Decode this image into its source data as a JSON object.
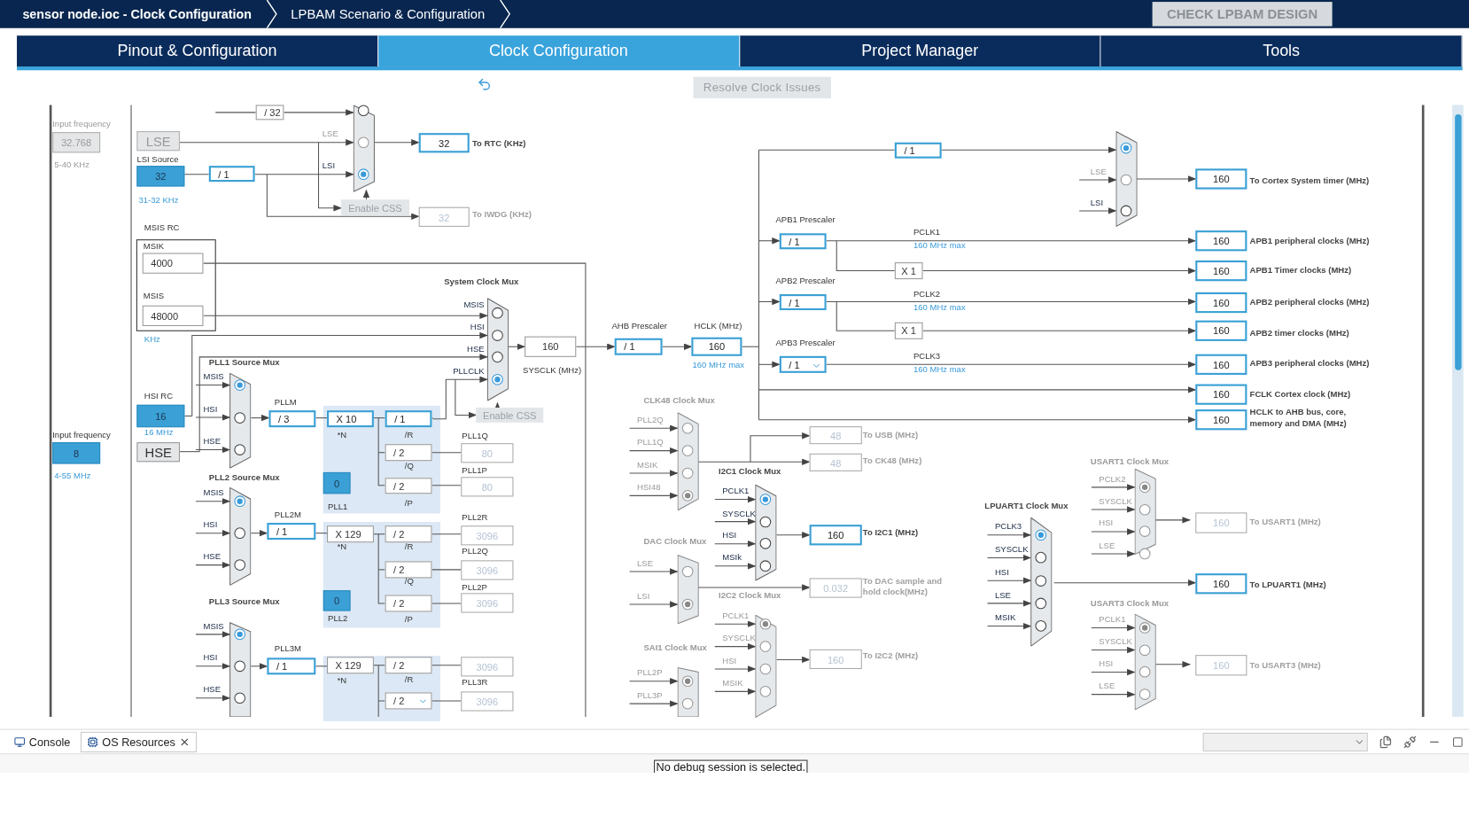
{
  "breadcrumbs": [
    {
      "label": "sensor node.ioc - Clock Configuration"
    },
    {
      "label": "LPBAM Scenario & Configuration"
    }
  ],
  "check_button": "CHECK LPBAM DESIGN",
  "tabs": [
    {
      "label": "Pinout & Configuration",
      "selected": false
    },
    {
      "label": "Clock Configuration",
      "selected": true
    },
    {
      "label": "Project Manager",
      "selected": false
    },
    {
      "label": "Tools",
      "selected": false
    }
  ],
  "toolbar": {
    "resolve_button": "Resolve Clock Issues"
  },
  "diagram": {
    "fields": [
      {
        "value": "32.768",
        "kind": "source_off"
      },
      {
        "value": "LSE",
        "kind": "source_off"
      },
      {
        "value": "32",
        "kind": "filled"
      },
      {
        "value": "/ 1",
        "kind": "active"
      },
      {
        "value": "/ 32",
        "kind": "plain"
      },
      {
        "value": "32",
        "kind": "active"
      },
      {
        "value": "32",
        "kind": "disabled"
      },
      {
        "value": "4000",
        "kind": "plain"
      },
      {
        "value": "48000",
        "kind": "plain"
      },
      {
        "value": "16",
        "kind": "filled"
      },
      {
        "value": "8",
        "kind": "filled"
      },
      {
        "value": "HSE",
        "kind": "source"
      },
      {
        "value": "160",
        "kind": "plain"
      },
      {
        "value": "/ 3",
        "kind": "active"
      },
      {
        "value": "X 10",
        "kind": "active"
      },
      {
        "value": "/ 1",
        "kind": "active"
      },
      {
        "value": "/ 2",
        "kind": "plain"
      },
      {
        "value": "0",
        "kind": "filled"
      },
      {
        "value": "/ 2",
        "kind": "plain"
      },
      {
        "value": "80",
        "kind": "disabled"
      },
      {
        "value": "80",
        "kind": "disabled"
      },
      {
        "value": "/ 1",
        "kind": "active"
      },
      {
        "value": "X 129",
        "kind": "plain"
      },
      {
        "value": "/ 2",
        "kind": "plain"
      },
      {
        "value": "/ 2",
        "kind": "plain"
      },
      {
        "value": "0",
        "kind": "filled"
      },
      {
        "value": "/ 2",
        "kind": "plain"
      },
      {
        "value": "3096",
        "kind": "disabled"
      },
      {
        "value": "3096",
        "kind": "disabled"
      },
      {
        "value": "3096",
        "kind": "disabled"
      },
      {
        "value": "/ 1",
        "kind": "active"
      },
      {
        "value": "X 129",
        "kind": "plain"
      },
      {
        "value": "/ 2",
        "kind": "plain"
      },
      {
        "value": "/ 2",
        "kind": "plain_select"
      },
      {
        "value": "3096",
        "kind": "disabled"
      },
      {
        "value": "3096",
        "kind": "disabled"
      },
      {
        "value": "/ 1",
        "kind": "active"
      },
      {
        "value": "160",
        "kind": "active"
      },
      {
        "value": "/ 1",
        "kind": "active"
      },
      {
        "value": "/ 1",
        "kind": "active"
      },
      {
        "value": "X 1",
        "kind": "plain"
      },
      {
        "value": "/ 1",
        "kind": "active"
      },
      {
        "value": "X 1",
        "kind": "plain"
      },
      {
        "value": "/ 1",
        "kind": "active_select"
      },
      {
        "value": "160",
        "kind": "active"
      },
      {
        "value": "160",
        "kind": "active"
      },
      {
        "value": "160",
        "kind": "active"
      },
      {
        "value": "160",
        "kind": "active"
      },
      {
        "value": "160",
        "kind": "active"
      },
      {
        "value": "160",
        "kind": "active"
      },
      {
        "value": "160",
        "kind": "active"
      },
      {
        "value": "160",
        "kind": "active"
      },
      {
        "value": "48",
        "kind": "disabled"
      },
      {
        "value": "48",
        "kind": "disabled"
      },
      {
        "value": "160",
        "kind": "active"
      },
      {
        "value": "0.032",
        "kind": "disabled"
      },
      {
        "value": "160",
        "kind": "disabled"
      },
      {
        "value": "160",
        "kind": "disabled"
      },
      {
        "value": "160",
        "kind": "active"
      },
      {
        "value": "160",
        "kind": "disabled"
      }
    ],
    "labels": [
      {
        "text": "Input frequency",
        "kind": "grey"
      },
      {
        "text": "5-40 KHz",
        "kind": "grey"
      },
      {
        "text": "LSI Source",
        "kind": "dark"
      },
      {
        "text": "31-32 KHz",
        "kind": "blue"
      },
      {
        "text": "To RTC (KHz)",
        "kind": "bold"
      },
      {
        "text": "To IWDG (KHz)",
        "kind": "greybold"
      },
      {
        "text": "MSIS RC",
        "kind": "dark"
      },
      {
        "text": "MSIK",
        "kind": "dark"
      },
      {
        "text": "MSIS",
        "kind": "dark"
      },
      {
        "text": "KHz",
        "kind": "blue"
      },
      {
        "text": "HSI RC",
        "kind": "dark"
      },
      {
        "text": "Input frequency",
        "kind": "dark"
      },
      {
        "text": "16 MHz",
        "kind": "blue"
      },
      {
        "text": "4-55 MHz",
        "kind": "blue"
      },
      {
        "text": "SYSCLK (MHz)",
        "kind": "dark"
      },
      {
        "text": "PLLM",
        "kind": "dark"
      },
      {
        "text": "*N",
        "kind": "dark"
      },
      {
        "text": "/R",
        "kind": "dark"
      },
      {
        "text": "/Q",
        "kind": "dark"
      },
      {
        "text": "PLL1",
        "kind": "dark"
      },
      {
        "text": "/P",
        "kind": "dark"
      },
      {
        "text": "PLL1Q",
        "kind": "dark"
      },
      {
        "text": "PLL1P",
        "kind": "dark"
      },
      {
        "text": "PLL2M",
        "kind": "dark"
      },
      {
        "text": "*N",
        "kind": "dark"
      },
      {
        "text": "/R",
        "kind": "dark"
      },
      {
        "text": "/Q",
        "kind": "dark"
      },
      {
        "text": "PLL2",
        "kind": "dark"
      },
      {
        "text": "/P",
        "kind": "dark"
      },
      {
        "text": "PLL2R",
        "kind": "dark"
      },
      {
        "text": "PLL2Q",
        "kind": "dark"
      },
      {
        "text": "PLL2P",
        "kind": "dark"
      },
      {
        "text": "PLL3M",
        "kind": "dark"
      },
      {
        "text": "*N",
        "kind": "dark"
      },
      {
        "text": "/R",
        "kind": "dark"
      },
      {
        "text": "PLL3R",
        "kind": "dark"
      },
      {
        "text": "AHB Prescaler",
        "kind": "dark"
      },
      {
        "text": "HCLK (MHz)",
        "kind": "dark"
      },
      {
        "text": "160 MHz max",
        "kind": "blue"
      },
      {
        "text": "APB1 Prescaler",
        "kind": "dark"
      },
      {
        "text": "PCLK1",
        "kind": "dark"
      },
      {
        "text": "160 MHz max",
        "kind": "blue"
      },
      {
        "text": "APB2 Prescaler",
        "kind": "dark"
      },
      {
        "text": "PCLK2",
        "kind": "dark"
      },
      {
        "text": "160 MHz max",
        "kind": "blue"
      },
      {
        "text": "APB3 Prescaler",
        "kind": "dark"
      },
      {
        "text": "PCLK3",
        "kind": "dark"
      },
      {
        "text": "160 MHz max",
        "kind": "blue"
      },
      {
        "text": "To Cortex System timer (MHz)",
        "kind": "bold"
      },
      {
        "text": "APB1 peripheral clocks (MHz)",
        "kind": "bold"
      },
      {
        "text": "APB1 Timer clocks (MHz)",
        "kind": "bold"
      },
      {
        "text": "APB2 peripheral clocks (MHz)",
        "kind": "bold"
      },
      {
        "text": "APB2 timer clocks (MHz)",
        "kind": "bold"
      },
      {
        "text": "APB3 peripheral clocks (MHz)",
        "kind": "bold"
      },
      {
        "text": "FCLK Cortex clock (MHz)",
        "kind": "bold"
      },
      {
        "text": "HCLK to AHB bus, core, memory and DMA (MHz)",
        "kind": "bold"
      },
      {
        "text": "To USB (MHz)",
        "kind": "greybold"
      },
      {
        "text": "To CK48 (MHz)",
        "kind": "greybold"
      },
      {
        "text": "To I2C1 (MHz)",
        "kind": "bold"
      },
      {
        "text": "To DAC sample and hold clock(MHz)",
        "kind": "greybold"
      },
      {
        "text": "To I2C2 (MHz)",
        "kind": "greybold"
      },
      {
        "text": "To USART1 (MHz)",
        "kind": "greybold"
      },
      {
        "text": "To LPUART1 (MHz)",
        "kind": "bold"
      },
      {
        "text": "To USART3 (MHz)",
        "kind": "greybold"
      }
    ],
    "muxes": [
      {
        "disabled": false,
        "inputs": [
          {
            "selected": false,
            "disabled": false
          },
          {
            "label": "LSE",
            "selected": false,
            "disabled": true
          },
          {
            "label": "LSI",
            "selected": true,
            "disabled": false
          }
        ]
      },
      {
        "title": "System Clock Mux",
        "disabled": false,
        "inputs": [
          {
            "label": "MSIS",
            "selected": false,
            "disabled": false
          },
          {
            "label": "HSI",
            "selected": false,
            "disabled": false
          },
          {
            "label": "HSE",
            "selected": false,
            "disabled": false
          },
          {
            "label": "PLLCLK",
            "selected": true,
            "disabled": false
          }
        ]
      },
      {
        "title": "PLL1 Source Mux",
        "disabled": false,
        "inputs": [
          {
            "label": "MSIS",
            "selected": true,
            "disabled": false
          },
          {
            "label": "HSI",
            "selected": false,
            "disabled": false
          },
          {
            "label": "HSE",
            "selected": false,
            "disabled": false
          }
        ]
      },
      {
        "title": "PLL2 Source Mux",
        "disabled": false,
        "inputs": [
          {
            "label": "MSIS",
            "selected": true,
            "disabled": false
          },
          {
            "label": "HSI",
            "selected": false,
            "disabled": false
          },
          {
            "label": "HSE",
            "selected": false,
            "disabled": false
          }
        ]
      },
      {
        "title": "PLL3 Source Mux",
        "disabled": false,
        "inputs": [
          {
            "label": "MSIS",
            "selected": true,
            "disabled": false
          },
          {
            "label": "HSI",
            "selected": false,
            "disabled": false
          },
          {
            "label": "HSE",
            "selected": false,
            "disabled": false
          }
        ]
      },
      {
        "title": "CLK48 Clock Mux",
        "disabled": true,
        "inputs": [
          {
            "label": "PLL2Q",
            "selected": false,
            "disabled": true
          },
          {
            "label": "PLL1Q",
            "selected": false,
            "disabled": true
          },
          {
            "label": "MSIK",
            "selected": false,
            "disabled": true
          },
          {
            "label": "HSI48",
            "selected": true,
            "disabled": true
          }
        ]
      },
      {
        "title": "I2C1 Clock Mux",
        "disabled": false,
        "inputs": [
          {
            "label": "PCLK1",
            "selected": true,
            "disabled": false
          },
          {
            "label": "SYSCLK",
            "selected": false,
            "disabled": false
          },
          {
            "label": "HSI",
            "selected": false,
            "disabled": false
          },
          {
            "label": "MSIk",
            "selected": false,
            "disabled": false
          }
        ]
      },
      {
        "title": "DAC Clock Mux",
        "disabled": true,
        "inputs": [
          {
            "label": "LSE",
            "selected": false,
            "disabled": true
          },
          {
            "label": "LSI",
            "selected": true,
            "disabled": true
          }
        ]
      },
      {
        "title": "I2C2 Clock Mux",
        "disabled": true,
        "inputs": [
          {
            "label": "PCLK1",
            "selected": true,
            "disabled": true
          },
          {
            "label": "SYSCLK",
            "selected": false,
            "disabled": true
          },
          {
            "label": "HSI",
            "selected": false,
            "disabled": true
          },
          {
            "label": "MSIK",
            "selected": false,
            "disabled": true
          }
        ]
      },
      {
        "title": "SAI1 Clock Mux",
        "disabled": true,
        "inputs": [
          {
            "label": "PLL2P",
            "selected": true,
            "disabled": true
          },
          {
            "label": "PLL3P",
            "selected": false,
            "disabled": true
          }
        ]
      },
      {
        "disabled": false,
        "inputs": [
          {
            "selected": true,
            "disabled": false
          },
          {
            "label": "LSE",
            "selected": false,
            "disabled": true
          },
          {
            "label": "LSI",
            "selected": false,
            "disabled": false
          }
        ]
      },
      {
        "title": "LPUART1 Clock Mux",
        "disabled": false,
        "inputs": [
          {
            "label": "PCLK3",
            "selected": true,
            "disabled": false
          },
          {
            "label": "SYSCLK",
            "selected": false,
            "disabled": false
          },
          {
            "label": "HSI",
            "selected": false,
            "disabled": false
          },
          {
            "label": "LSE",
            "selected": false,
            "disabled": false
          },
          {
            "label": "MSIK",
            "selected": false,
            "disabled": false
          }
        ]
      },
      {
        "title": "USART1 Clock Mux",
        "disabled": true,
        "inputs": [
          {
            "label": "PCLK2",
            "selected": true,
            "disabled": true
          },
          {
            "label": "SYSCLK",
            "selected": false,
            "disabled": true
          },
          {
            "label": "HSI",
            "selected": false,
            "disabled": true
          },
          {
            "label": "LSE",
            "selected": false,
            "disabled": true
          }
        ]
      },
      {
        "title": "USART3 Clock Mux",
        "disabled": true,
        "inputs": [
          {
            "label": "PCLK1",
            "selected": true,
            "disabled": true
          },
          {
            "label": "SYSCLK",
            "selected": false,
            "disabled": true
          },
          {
            "label": "HSI",
            "selected": false,
            "disabled": true
          },
          {
            "label": "LSE",
            "selected": false,
            "disabled": true
          }
        ]
      }
    ],
    "buttons": [
      {
        "label": "Enable CSS"
      },
      {
        "label": "Enable CSS"
      }
    ]
  },
  "bottom_panel": {
    "tabs": [
      {
        "label": "Console",
        "selected": false
      },
      {
        "label": "OS Resources",
        "selected": true
      }
    ],
    "message": "No debug session is selected."
  }
}
